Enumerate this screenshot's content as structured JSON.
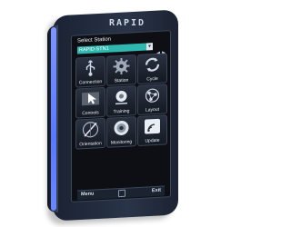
{
  "device": {
    "brand": "RAPID"
  },
  "station": {
    "title": "Select Station",
    "selected": "RAPID-STN1"
  },
  "tiles": [
    {
      "label": "Connection",
      "icon": "usb-icon"
    },
    {
      "label": "Station",
      "icon": "gear-icon"
    },
    {
      "label": "Cycle",
      "icon": "cycle-icon"
    },
    {
      "label": "Controls",
      "icon": "pointer-icon"
    },
    {
      "label": "Training",
      "icon": "training-icon"
    },
    {
      "label": "Layout",
      "icon": "network-icon"
    },
    {
      "label": "Orientation",
      "icon": "compass-icon"
    },
    {
      "label": "Monitoring",
      "icon": "monitor-icon"
    },
    {
      "label": "Update",
      "icon": "signal-icon"
    }
  ],
  "bottom": {
    "menu": "Menu",
    "exit": "Exit"
  }
}
